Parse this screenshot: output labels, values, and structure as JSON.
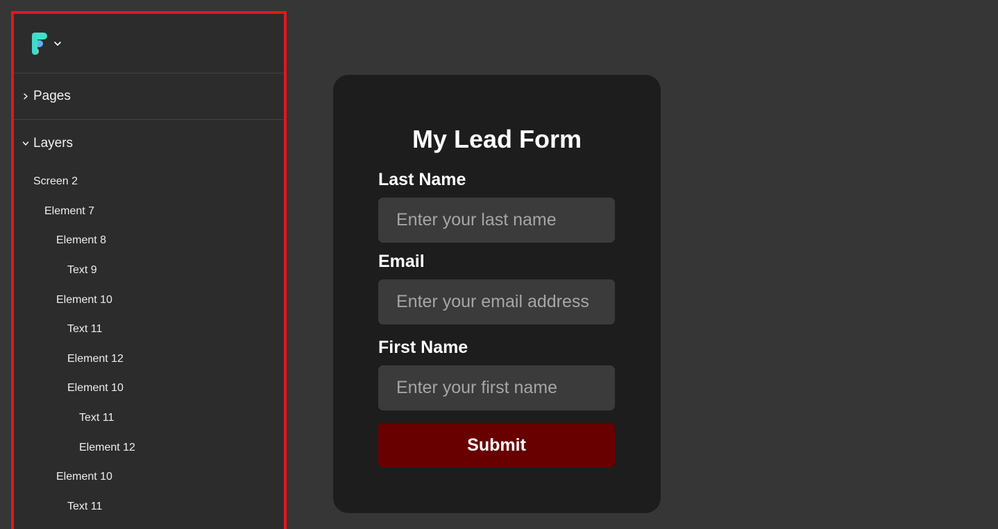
{
  "app": {
    "logo_icon": "figma-style-logo-icon",
    "logo_colors": [
      "#3de3c4",
      "#5ab4f0",
      "#7be0b2"
    ]
  },
  "sidebar": {
    "highlight_color": "#e8141a",
    "pages_label": "Pages",
    "layers_label": "Layers",
    "layers": [
      {
        "label": "Screen 2",
        "depth": 0
      },
      {
        "label": "Element 7",
        "depth": 1
      },
      {
        "label": "Element 8",
        "depth": 2
      },
      {
        "label": "Text 9",
        "depth": 3
      },
      {
        "label": "Element 10",
        "depth": 2
      },
      {
        "label": "Text 11",
        "depth": 3
      },
      {
        "label": "Element 12",
        "depth": 3
      },
      {
        "label": "Element 10",
        "depth": 3
      },
      {
        "label": "Text 11",
        "depth": 4
      },
      {
        "label": "Element 12",
        "depth": 4
      },
      {
        "label": "Element 10",
        "depth": 2
      },
      {
        "label": "Text 11",
        "depth": 3
      }
    ]
  },
  "form": {
    "title": "My Lead Form",
    "fields": [
      {
        "label": "Last Name",
        "placeholder": "Enter your last name",
        "value": ""
      },
      {
        "label": "Email",
        "placeholder": "Enter your email address",
        "value": ""
      },
      {
        "label": "First Name",
        "placeholder": "Enter your first name",
        "value": ""
      }
    ],
    "submit_label": "Submit",
    "submit_color": "#680000"
  }
}
